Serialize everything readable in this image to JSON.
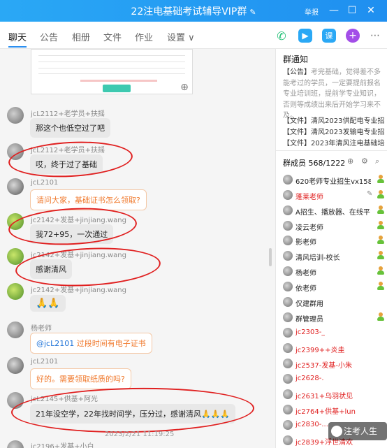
{
  "window": {
    "title": "22注电基础考试辅导VIP群",
    "title_edit_icon": "edit-icon",
    "report": "举报",
    "controls": [
      "minimize-icon",
      "maximize-icon",
      "close-icon"
    ]
  },
  "tabs": [
    "聊天",
    "公告",
    "相册",
    "文件",
    "作业",
    "设置"
  ],
  "settings_dropdown": "∨",
  "chat": {
    "messages": [
      {
        "sender": "jcL2112+老学员+扶摇",
        "text": "那这个也低空过了吧"
      },
      {
        "sender": "jcL2112+老学员+扶摇",
        "text": "哎，终于过了基础"
      },
      {
        "sender": "jcL2101",
        "text": "请问大家，基础证书怎么领取?"
      },
      {
        "sender": "jc2142+发基+jinjiang.wang",
        "text": "我72+95，一次通过"
      },
      {
        "sender": "jc2142+发基+jinjiang.wang",
        "text": "感谢清风"
      },
      {
        "sender": "jc2142+发基+jinjiang.wang",
        "text": "🙏🙏"
      },
      {
        "sender": "杨老师",
        "mention": "@jcL2101",
        "text": " 过段时间有电子证书"
      },
      {
        "sender": "jcL2101",
        "text": "好的。需要领取纸质的吗?"
      },
      {
        "sender": "jcL2145+供基+阿光",
        "text": "21年没空学，22年找时间学，压分过，感谢清风🙏🙏🙏"
      },
      {
        "sender": "jc2196+发基+小白",
        "text": ""
      }
    ],
    "timestamp": "2023/2/21 11:19:25"
  },
  "sidebar": {
    "notice_title": "群通知",
    "notice_lead": "【公告】",
    "notice_text": "考完基础，觉得差不多能考过的学员，一定要提前报名专业培训班，提前学专业知识，否则等成绩出来后开始学习来不及。",
    "files": [
      "【文件】清风2023供配电专业招...",
      "【文件】清风2023发输电专业招...",
      "【文件】2023年清风注电基础培..."
    ],
    "members_title": "群成员 568/1222",
    "members": [
      {
        "name": "620老师专业招生vx1585...",
        "color": "#222"
      },
      {
        "name": "蓬莱老师",
        "color": "#e02020"
      },
      {
        "name": "A招生、播放器、在线平台问题",
        "color": "#222"
      },
      {
        "name": "凌云老师",
        "color": "#222"
      },
      {
        "name": "影老师",
        "color": "#222"
      },
      {
        "name": "清风培训-校长",
        "color": "#222"
      },
      {
        "name": "杨老师",
        "color": "#222"
      },
      {
        "name": "依老师",
        "color": "#222"
      },
      {
        "name": "仅建群用",
        "color": "#222"
      },
      {
        "name": "群管理员",
        "color": "#222"
      },
      {
        "name": "jc2303-_",
        "color": "#e02020"
      },
      {
        "name": "jc2399++炎圭",
        "color": "#e02020"
      },
      {
        "name": "jc2537-发基-小朱",
        "color": "#e02020"
      },
      {
        "name": "jc2628-.",
        "color": "#e02020"
      },
      {
        "name": "jc2631+乌羽状见",
        "color": "#e02020"
      },
      {
        "name": "jc2764+供基+lun",
        "color": "#e02020"
      },
      {
        "name": "jc2830-...",
        "color": "#e02020"
      },
      {
        "name": "jc2839+浮世清欢",
        "color": "#e02020"
      }
    ]
  },
  "watermark": "注考人生"
}
